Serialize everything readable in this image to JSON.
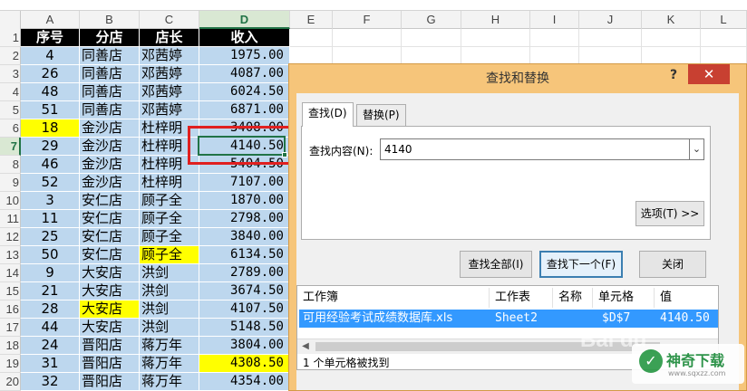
{
  "columns": [
    "A",
    "B",
    "C",
    "D",
    "E",
    "F",
    "G",
    "H",
    "I",
    "J",
    "K",
    "L"
  ],
  "active_column": "D",
  "active_row": 7,
  "header_row": {
    "num": 1,
    "cells": [
      "序号",
      "分店",
      "店长",
      "收入"
    ]
  },
  "rows": [
    {
      "num": 2,
      "id": "4",
      "store": "同善店",
      "manager": "邓茜婷",
      "income": "1975.00"
    },
    {
      "num": 3,
      "id": "26",
      "store": "同善店",
      "manager": "邓茜婷",
      "income": "4087.00"
    },
    {
      "num": 4,
      "id": "48",
      "store": "同善店",
      "manager": "邓茜婷",
      "income": "6024.50"
    },
    {
      "num": 5,
      "id": "51",
      "store": "同善店",
      "manager": "邓茜婷",
      "income": "6871.00"
    },
    {
      "num": 6,
      "id": "18",
      "store": "金沙店",
      "manager": "杜梓明",
      "income": "3408.00",
      "hl": "id"
    },
    {
      "num": 7,
      "id": "29",
      "store": "金沙店",
      "manager": "杜梓明",
      "income": "4140.50"
    },
    {
      "num": 8,
      "id": "46",
      "store": "金沙店",
      "manager": "杜梓明",
      "income": "5404.50"
    },
    {
      "num": 9,
      "id": "52",
      "store": "金沙店",
      "manager": "杜梓明",
      "income": "7107.00"
    },
    {
      "num": 10,
      "id": "3",
      "store": "安仁店",
      "manager": "顾子全",
      "income": "1870.00"
    },
    {
      "num": 11,
      "id": "11",
      "store": "安仁店",
      "manager": "顾子全",
      "income": "2798.00"
    },
    {
      "num": 12,
      "id": "25",
      "store": "安仁店",
      "manager": "顾子全",
      "income": "3840.00"
    },
    {
      "num": 13,
      "id": "50",
      "store": "安仁店",
      "manager": "顾子全",
      "income": "6134.50",
      "hl": "manager"
    },
    {
      "num": 14,
      "id": "9",
      "store": "大安店",
      "manager": "洪剑",
      "income": "2789.00"
    },
    {
      "num": 15,
      "id": "21",
      "store": "大安店",
      "manager": "洪剑",
      "income": "3674.50"
    },
    {
      "num": 16,
      "id": "28",
      "store": "大安店",
      "manager": "洪剑",
      "income": "4107.50",
      "hl": "store"
    },
    {
      "num": 17,
      "id": "44",
      "store": "大安店",
      "manager": "洪剑",
      "income": "5148.50"
    },
    {
      "num": 18,
      "id": "24",
      "store": "晋阳店",
      "manager": "蒋万年",
      "income": "3804.00"
    },
    {
      "num": 19,
      "id": "31",
      "store": "晋阳店",
      "manager": "蒋万年",
      "income": "4308.50",
      "hl": "income"
    },
    {
      "num": 20,
      "id": "32",
      "store": "晋阳店",
      "manager": "蒋万年",
      "income": "4354.00"
    }
  ],
  "dialog": {
    "title": "查找和替换",
    "help": "?",
    "close": "✕",
    "tab_find": "查找(D)",
    "tab_replace": "替换(P)",
    "find_label": "查找内容(N):",
    "find_value": "4140",
    "dropdown_icon": "chevron-down",
    "options_btn": "选项(T) >>",
    "find_all_btn": "查找全部(I)",
    "find_next_btn": "查找下一个(F)",
    "close_btn": "关闭",
    "results_headers": {
      "workbook": "工作簿",
      "sheet": "工作表",
      "name": "名称",
      "cell": "单元格",
      "value": "值"
    },
    "result": {
      "workbook": "可用经验考试成绩数据库.xls",
      "sheet": "Sheet2",
      "cell": "$D$7",
      "value": "4140.50"
    },
    "status": "1 个单元格被找到"
  },
  "watermark": {
    "brand": "神奇下载",
    "url": "www.sqxzz.com",
    "baidu": "Bai du"
  },
  "colors": {
    "accent": "#217346",
    "data_fill": "#bdd7ee",
    "highlight": "#ffff00",
    "dialog_frame": "#f6c57a",
    "close_red": "#c84031",
    "selection": "#3399ff",
    "red_box": "#e02020"
  }
}
